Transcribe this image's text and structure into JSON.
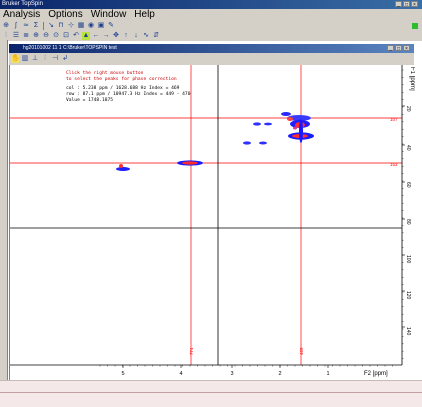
{
  "window": {
    "title": "Bruker TopSpin"
  },
  "menu": [
    "Analysis",
    "Options",
    "Window",
    "Help"
  ],
  "inner_window": {
    "title": "hg20101002 11 1 C:\\Bruker\\TOPSPIN test"
  },
  "info": {
    "line1": "Click the right mouse button",
    "line2": "to select the peaks for phase correction",
    "line3": "col : 5.238 ppm / 1628.688 Hz Index = 469",
    "line4": "row : 87.1 ppm / 10947.3 Hz Index = 449 - 470",
    "line5": "Value = 1748.1875"
  },
  "axes": {
    "f2_label": "F2 [ppm]",
    "f1_label": "F1 [ppm]",
    "f2_ticks": [
      "5",
      "4",
      "3",
      "2",
      "1"
    ],
    "f1_ticks": [
      "20",
      "40",
      "60",
      "80",
      "100",
      "120",
      "140"
    ],
    "row_marker_1": "107",
    "row_marker_2": "153",
    "col_marker_1": "774",
    "col_marker_2": "469"
  },
  "colors": {
    "crosshair": "#ff0000",
    "peaks_positive": "#0000ff",
    "peaks_negative": "#ff0000",
    "border": "#000000"
  }
}
